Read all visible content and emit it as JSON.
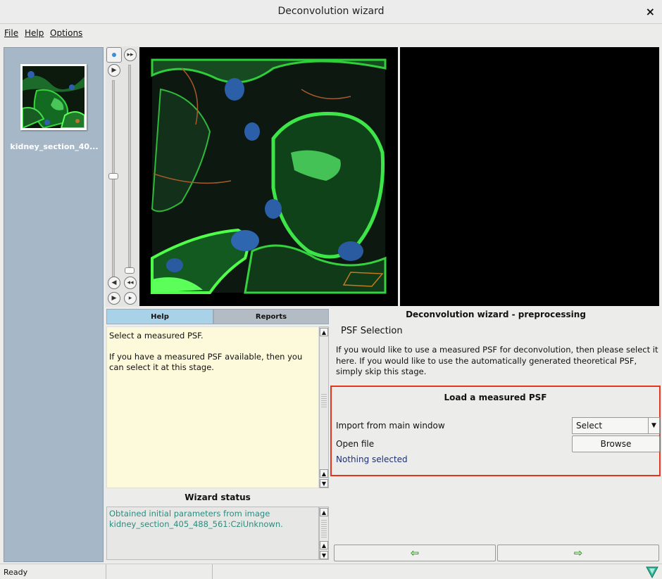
{
  "window": {
    "title": "Deconvolution wizard",
    "close_glyph": "×"
  },
  "menu": {
    "file": "File",
    "help": "Help",
    "options": "Options"
  },
  "sidebar": {
    "thumbnail_label": "kidney_section_40..."
  },
  "tabs": {
    "help": "Help",
    "reports": "Reports"
  },
  "help_text": {
    "line1": "Select a measured PSF.",
    "line2": "If you have a measured PSF available, then you can select it at this stage."
  },
  "wizard_status": {
    "title": "Wizard status",
    "message": "Obtained initial parameters from image kidney_section_405_488_561:CziUnknown."
  },
  "preprocessing": {
    "title": "Deconvolution wizard - preprocessing",
    "psf_title": "PSF Selection",
    "description": "If you would like to use a measured PSF for deconvolution, then please select it here. If you would like to use the automatically generated theoretical PSF, simply skip this stage."
  },
  "load_psf": {
    "title": "Load a measured PSF",
    "import_label": "Import from main window",
    "select_value": "Select",
    "open_file_label": "Open file",
    "browse_label": "Browse",
    "nothing_selected": "Nothing selected"
  },
  "nav": {
    "back_arrow": "⇦",
    "next_arrow": "⇨"
  },
  "status": {
    "text": "Ready"
  },
  "colors": {
    "accent_red": "#e8341d",
    "status_teal": "#2b8c80",
    "tab_active": "#a9d2e9",
    "arrow_green": "#2eaa22"
  }
}
